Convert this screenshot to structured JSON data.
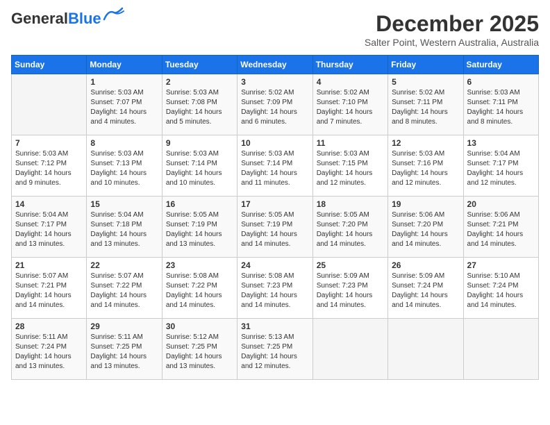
{
  "logo": {
    "general": "General",
    "blue": "Blue"
  },
  "title": "December 2025",
  "location": "Salter Point, Western Australia, Australia",
  "weekdays": [
    "Sunday",
    "Monday",
    "Tuesday",
    "Wednesday",
    "Thursday",
    "Friday",
    "Saturday"
  ],
  "weeks": [
    [
      {
        "day": "",
        "info": ""
      },
      {
        "day": "1",
        "info": "Sunrise: 5:03 AM\nSunset: 7:07 PM\nDaylight: 14 hours\nand 4 minutes."
      },
      {
        "day": "2",
        "info": "Sunrise: 5:03 AM\nSunset: 7:08 PM\nDaylight: 14 hours\nand 5 minutes."
      },
      {
        "day": "3",
        "info": "Sunrise: 5:02 AM\nSunset: 7:09 PM\nDaylight: 14 hours\nand 6 minutes."
      },
      {
        "day": "4",
        "info": "Sunrise: 5:02 AM\nSunset: 7:10 PM\nDaylight: 14 hours\nand 7 minutes."
      },
      {
        "day": "5",
        "info": "Sunrise: 5:02 AM\nSunset: 7:11 PM\nDaylight: 14 hours\nand 8 minutes."
      },
      {
        "day": "6",
        "info": "Sunrise: 5:03 AM\nSunset: 7:11 PM\nDaylight: 14 hours\nand 8 minutes."
      }
    ],
    [
      {
        "day": "7",
        "info": "Sunrise: 5:03 AM\nSunset: 7:12 PM\nDaylight: 14 hours\nand 9 minutes."
      },
      {
        "day": "8",
        "info": "Sunrise: 5:03 AM\nSunset: 7:13 PM\nDaylight: 14 hours\nand 10 minutes."
      },
      {
        "day": "9",
        "info": "Sunrise: 5:03 AM\nSunset: 7:14 PM\nDaylight: 14 hours\nand 10 minutes."
      },
      {
        "day": "10",
        "info": "Sunrise: 5:03 AM\nSunset: 7:14 PM\nDaylight: 14 hours\nand 11 minutes."
      },
      {
        "day": "11",
        "info": "Sunrise: 5:03 AM\nSunset: 7:15 PM\nDaylight: 14 hours\nand 12 minutes."
      },
      {
        "day": "12",
        "info": "Sunrise: 5:03 AM\nSunset: 7:16 PM\nDaylight: 14 hours\nand 12 minutes."
      },
      {
        "day": "13",
        "info": "Sunrise: 5:04 AM\nSunset: 7:17 PM\nDaylight: 14 hours\nand 12 minutes."
      }
    ],
    [
      {
        "day": "14",
        "info": "Sunrise: 5:04 AM\nSunset: 7:17 PM\nDaylight: 14 hours\nand 13 minutes."
      },
      {
        "day": "15",
        "info": "Sunrise: 5:04 AM\nSunset: 7:18 PM\nDaylight: 14 hours\nand 13 minutes."
      },
      {
        "day": "16",
        "info": "Sunrise: 5:05 AM\nSunset: 7:19 PM\nDaylight: 14 hours\nand 13 minutes."
      },
      {
        "day": "17",
        "info": "Sunrise: 5:05 AM\nSunset: 7:19 PM\nDaylight: 14 hours\nand 14 minutes."
      },
      {
        "day": "18",
        "info": "Sunrise: 5:05 AM\nSunset: 7:20 PM\nDaylight: 14 hours\nand 14 minutes."
      },
      {
        "day": "19",
        "info": "Sunrise: 5:06 AM\nSunset: 7:20 PM\nDaylight: 14 hours\nand 14 minutes."
      },
      {
        "day": "20",
        "info": "Sunrise: 5:06 AM\nSunset: 7:21 PM\nDaylight: 14 hours\nand 14 minutes."
      }
    ],
    [
      {
        "day": "21",
        "info": "Sunrise: 5:07 AM\nSunset: 7:21 PM\nDaylight: 14 hours\nand 14 minutes."
      },
      {
        "day": "22",
        "info": "Sunrise: 5:07 AM\nSunset: 7:22 PM\nDaylight: 14 hours\nand 14 minutes."
      },
      {
        "day": "23",
        "info": "Sunrise: 5:08 AM\nSunset: 7:22 PM\nDaylight: 14 hours\nand 14 minutes."
      },
      {
        "day": "24",
        "info": "Sunrise: 5:08 AM\nSunset: 7:23 PM\nDaylight: 14 hours\nand 14 minutes."
      },
      {
        "day": "25",
        "info": "Sunrise: 5:09 AM\nSunset: 7:23 PM\nDaylight: 14 hours\nand 14 minutes."
      },
      {
        "day": "26",
        "info": "Sunrise: 5:09 AM\nSunset: 7:24 PM\nDaylight: 14 hours\nand 14 minutes."
      },
      {
        "day": "27",
        "info": "Sunrise: 5:10 AM\nSunset: 7:24 PM\nDaylight: 14 hours\nand 14 minutes."
      }
    ],
    [
      {
        "day": "28",
        "info": "Sunrise: 5:11 AM\nSunset: 7:24 PM\nDaylight: 14 hours\nand 13 minutes."
      },
      {
        "day": "29",
        "info": "Sunrise: 5:11 AM\nSunset: 7:25 PM\nDaylight: 14 hours\nand 13 minutes."
      },
      {
        "day": "30",
        "info": "Sunrise: 5:12 AM\nSunset: 7:25 PM\nDaylight: 14 hours\nand 13 minutes."
      },
      {
        "day": "31",
        "info": "Sunrise: 5:13 AM\nSunset: 7:25 PM\nDaylight: 14 hours\nand 12 minutes."
      },
      {
        "day": "",
        "info": ""
      },
      {
        "day": "",
        "info": ""
      },
      {
        "day": "",
        "info": ""
      }
    ]
  ]
}
